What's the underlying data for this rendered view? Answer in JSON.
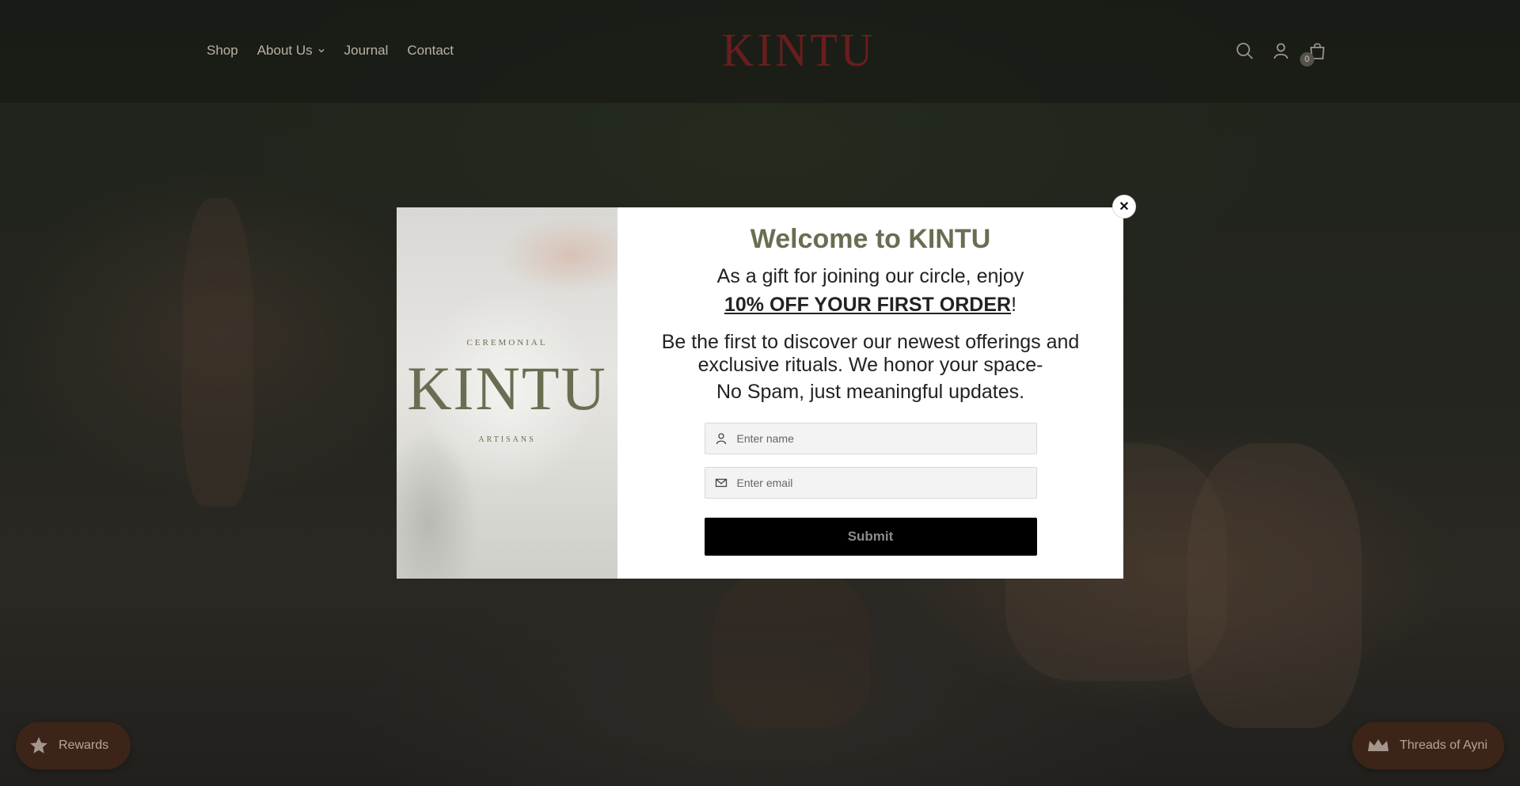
{
  "header": {
    "nav": [
      {
        "label": "Shop"
      },
      {
        "label": "About Us"
      },
      {
        "label": "Journal"
      },
      {
        "label": "Contact"
      }
    ],
    "logo": "KINTU",
    "cart_count": "0",
    "logo_color": "#6b1d1d"
  },
  "popup": {
    "image": {
      "top_text": "CEREMONIAL",
      "brand": "KINTU",
      "bottom_text": "ARTISANS"
    },
    "title": "Welcome to KINTU",
    "gift_line": "As a gift for joining our circle, enjoy",
    "offer": "10% OFF YOUR FIRST ORDER",
    "offer_suffix": "!",
    "description": "Be the first to discover our newest offerings and exclusive rituals. We honor your space-",
    "no_spam": "No Spam, just meaningful updates.",
    "name_placeholder": "Enter name",
    "email_placeholder": "Enter email",
    "submit_label": "Submit",
    "close_label": "✕",
    "accent_color": "#6b6d52"
  },
  "widgets": {
    "rewards_label": "Rewards",
    "threads_label": "Threads of Ayni",
    "color": "#3d2419"
  }
}
